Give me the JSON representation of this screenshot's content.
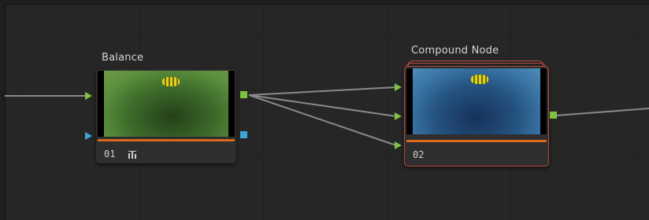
{
  "nodes": [
    {
      "title": "Balance",
      "number": "01",
      "icon": "bar-chart-icon",
      "image_tone": "green"
    },
    {
      "title": "Compound Node",
      "number": "02",
      "image_tone": "blue"
    }
  ],
  "colors": {
    "input_port": "#7ec242",
    "key_port": "#3ba4d9",
    "wire": "#8a8a8a",
    "compound_outline": "#b54a3c",
    "node_bar": "#d96a1d"
  }
}
